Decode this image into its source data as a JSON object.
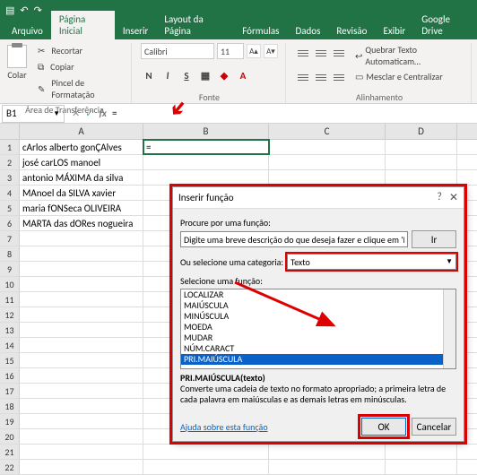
{
  "menubar": {
    "arquivo": "Arquivo",
    "inicial": "Página Inicial",
    "inserir": "Inserir",
    "layout": "Layout da Página",
    "formulas": "Fórmulas",
    "dados": "Dados",
    "revisao": "Revisão",
    "exibir": "Exibir",
    "gdrive": "Google Drive"
  },
  "ribbon": {
    "paste": "Colar",
    "cut": "Recortar",
    "copy": "Copiar",
    "brush": "Pincel de Formatação",
    "clip_group": "Área de Transferência",
    "font_name": "Calibri",
    "font_size": "11",
    "font_group": "Fonte",
    "wrap": "Quebrar Texto Automaticam…",
    "merge": "Mesclar e Centralizar",
    "align_group": "Alinhamento"
  },
  "namebox": "B1",
  "formula": "=",
  "cols": {
    "a": "A",
    "b": "B",
    "c": "C",
    "d": "D"
  },
  "rows": [
    {
      "n": "1",
      "a": "cArlos alberto gonÇAlves",
      "b": "="
    },
    {
      "n": "2",
      "a": "josé carLOS manoel"
    },
    {
      "n": "3",
      "a": "antonio MÁXIMA da silva"
    },
    {
      "n": "4",
      "a": "MAnoel da SILVA xavier"
    },
    {
      "n": "5",
      "a": "maria fONSeca OLIVEIRA"
    },
    {
      "n": "6",
      "a": "MARTA das dORes nogueira"
    },
    {
      "n": "7"
    },
    {
      "n": "8"
    },
    {
      "n": "9"
    },
    {
      "n": "10"
    },
    {
      "n": "11"
    },
    {
      "n": "12"
    },
    {
      "n": "13"
    },
    {
      "n": "14"
    },
    {
      "n": "15"
    },
    {
      "n": "16"
    },
    {
      "n": "17"
    },
    {
      "n": "18"
    },
    {
      "n": "19"
    },
    {
      "n": "20"
    },
    {
      "n": "21"
    },
    {
      "n": "22"
    }
  ],
  "dialog": {
    "title": "Inserir função",
    "search_label": "Procure por uma função:",
    "search_value": "Digite uma breve descrição do que deseja fazer e clique em 'Ir'",
    "go": "Ir",
    "cat_label": "Ou selecione uma categoria:",
    "cat_value": "Texto",
    "list_label": "Selecione uma função:",
    "list": [
      "LOCALIZAR",
      "MAIÚSCULA",
      "MINÚSCULA",
      "MOEDA",
      "MUDAR",
      "NÚM.CARACT",
      "PRI.MAIÚSCULA"
    ],
    "selected": "PRI.MAIÚSCULA",
    "desc_sig": "PRI.MAIÚSCULA(texto)",
    "desc_txt": "Converte uma cadeia de texto no formato apropriado; a primeira letra de cada palavra em maiúsculas e as demais letras em minúsculas.",
    "help": "Ajuda sobre esta função",
    "ok": "OK",
    "cancel": "Cancelar"
  }
}
